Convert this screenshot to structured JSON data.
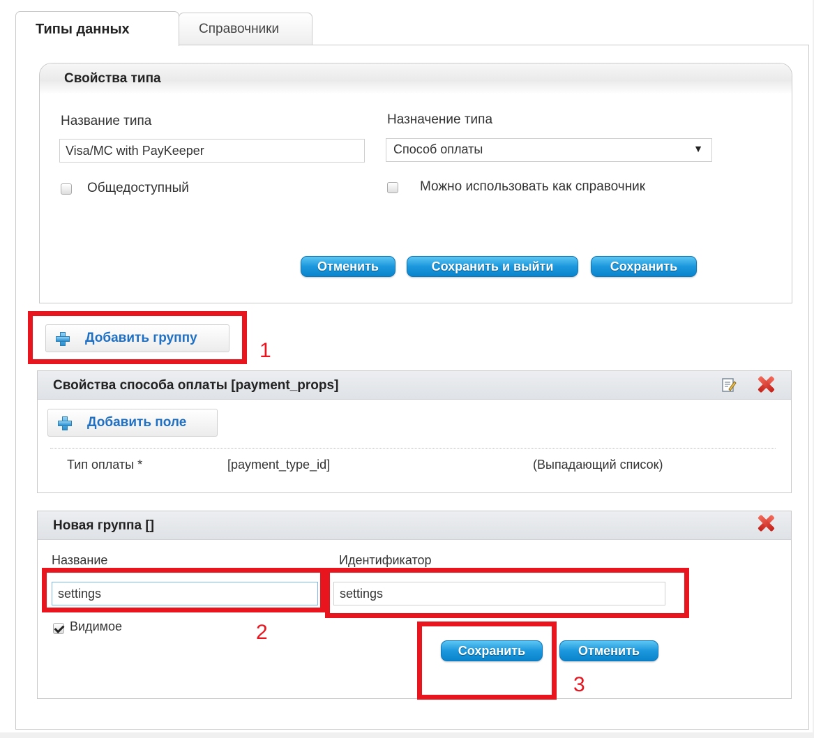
{
  "tabs": [
    "Типы данных",
    "Справочники"
  ],
  "type_props": {
    "title": "Свойства типа",
    "name_label": "Название типа",
    "name_value": "Visa/MC with PayKeeper",
    "purpose_label": "Назначение типа",
    "purpose_value": "Способ оплаты",
    "public_label": "Общедоступный",
    "public_checked": false,
    "reference_label": "Можно использовать как справочник",
    "reference_checked": false,
    "buttons": {
      "cancel": "Отменить",
      "save_exit": "Сохранить и выйти",
      "save": "Сохранить"
    }
  },
  "add_group_label": "Добавить группу",
  "payment_group": {
    "title": "Свойства способа оплаты [payment_props]",
    "add_field_label": "Добавить поле",
    "field": {
      "name": "Тип оплаты *",
      "identifier": "[payment_type_id]",
      "type": "(Выпадающий список)"
    }
  },
  "new_group": {
    "title": "Новая группа []",
    "name_label": "Название",
    "name_value": "settings",
    "id_label": "Идентификатор",
    "id_value": "settings",
    "visible_label": "Видимое",
    "visible_checked": true,
    "save_label": "Сохранить",
    "cancel_label": "Отменить"
  },
  "annotations": [
    "1",
    "2",
    "3"
  ],
  "colors": {
    "annotation": "#e8141e",
    "button": "#1c97dd",
    "link": "#1f6fc2"
  }
}
